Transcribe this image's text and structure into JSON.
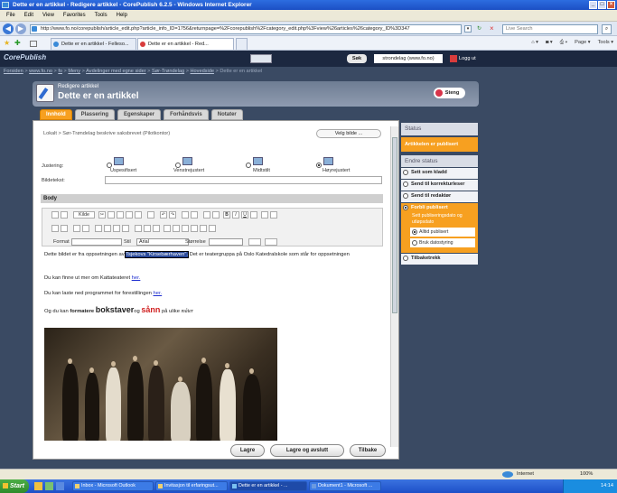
{
  "window": {
    "title": "Dette er en artikkel - Redigere artikkel - CorePublish 6.2.5 - Windows Internet Explorer"
  },
  "menu": [
    "File",
    "Edit",
    "View",
    "Favorites",
    "Tools",
    "Help"
  ],
  "address": {
    "url": "http://www.fo.no/corepublish/article_edit.php?article_info_ID=1756&returnpage=%2Fcorepublish%2Fcategory_edit.php%3Fview%26articles%26category_ID%3D347",
    "search_placeholder": "Live Search"
  },
  "ie_tabs": [
    "Dette er en artikkel - Felleso...",
    "Dette er en artikkel - Red..."
  ],
  "ie_tools": [
    "Page ▾",
    "Tools ▾"
  ],
  "cp": {
    "logo": "CorePublish",
    "search_label": "Søk",
    "site": "strondelag (www.fo.no)",
    "logout": "Logg ut"
  },
  "breadcrumbs": [
    "Forsiden",
    "www.fo.no",
    "fo",
    "Meny",
    "Avdelinger med egne sider",
    "Sør-Trøndelag",
    "Hovedside",
    "Dette er en artikkel"
  ],
  "header": {
    "subtitle": "Redigere artikkel",
    "title": "Dette er en artikkel",
    "close": "Steng"
  },
  "tabs": [
    "Innhold",
    "Plassering",
    "Egenskaper",
    "Forhåndsvis",
    "Notater"
  ],
  "form": {
    "top_text": "Lokalt > Sør-Trøndelag beskrive saksbrevet (Pilotkontor)",
    "choose_image": "Velg bilde ...",
    "justering_label": "Justering:",
    "align_options": [
      "Uspesifisert",
      "Venstrejustert",
      "Midtstilt",
      "Høyrejustert"
    ],
    "bildetekst_label": "Bildetekst:",
    "body_label": "Body"
  },
  "toolbar": {
    "kilde": "Kilde",
    "format_label": "Format",
    "stil_label": "Stil",
    "stil_value": "Arial",
    "storrelse_label": "Størrelse"
  },
  "editor": {
    "p1_before": "Dette bildet er fra oppsetningen av ",
    "p1_highlight": "Tsjekovs \"Kirsebærhaven\".",
    "p1_after": " Det er teatergruppa på Oslo Katedralskole som står for oppsetningen",
    "p2_text": "Du kan finne ut mer om Kattateateret ",
    "p2_link": "her.",
    "p3_text": "Du kan laste ned programmet for forestillingen ",
    "p3_link": "her.",
    "p4_a": "Og du kan ",
    "p4_b": "formatere ",
    "p4_c": "bokstaver",
    "p4_d": "og ",
    "p4_e": "sånn",
    "p4_f": " på ulike ",
    "p4_g": "måter"
  },
  "buttons": [
    "Lagre",
    "Lagre og avslutt",
    "Tilbake"
  ],
  "status": {
    "heading": "Status",
    "current": "Artikkelen er publisert",
    "change_heading": "Endre status",
    "options": [
      "Sett som kladd",
      "Send til korrekturleser",
      "Send til redaktør",
      "Forbli publisert"
    ],
    "sub_heading": "Sett publiseringsdato og utløpsdato",
    "sub_options": [
      "Alltid publisert",
      "Bruk datostyring"
    ],
    "withdraw": "Tilbaketrekk"
  },
  "ie_status": {
    "zone": "Internet",
    "zoom": "100%"
  },
  "taskbar": {
    "start": "Start",
    "tasks": [
      "Inbox - Microsoft Outlook",
      "Invitasjon til erfaringsut...",
      "Dette er en artikkel - ...",
      "Dokument1 - Microsoft ..."
    ],
    "time": "14:14"
  },
  "colors": {
    "accent": "#f7a020",
    "panel": "#3a4a63"
  }
}
